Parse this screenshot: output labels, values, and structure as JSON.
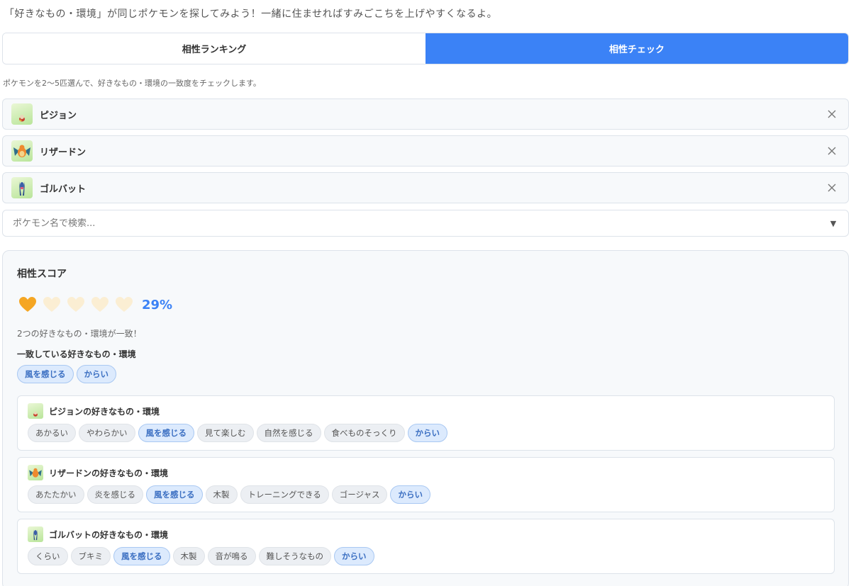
{
  "intro_text": "「好きなもの・環境」が同じポケモンを探してみよう！一緒に住ませればすみごこちを上げやすくなるよ。",
  "tabs": [
    {
      "label": "相性ランキング",
      "active": false
    },
    {
      "label": "相性チェック",
      "active": true
    }
  ],
  "instruction": "ポケモンを2〜5匹選んで、好きなもの・環境の一致度をチェックします。",
  "selected": [
    {
      "name": "ピジョン",
      "icon": "pidgeotto-icon"
    },
    {
      "name": "リザードン",
      "icon": "charizard-icon"
    },
    {
      "name": "ゴルバット",
      "icon": "golbat-icon"
    }
  ],
  "search": {
    "placeholder": "ポケモン名で検索..."
  },
  "result": {
    "title": "相性スコア",
    "hearts_total": 5,
    "hearts_filled": 1,
    "score": "29%",
    "match_text": "2つの好きなもの・環境が一致！",
    "match_heading": "一致している好きなもの・環境",
    "matched_tags": [
      "風を感じる",
      "からい"
    ],
    "cards": [
      {
        "title": "ピジョンの好きなもの・環境",
        "tags": [
          {
            "label": "あかるい",
            "match": false
          },
          {
            "label": "やわらかい",
            "match": false
          },
          {
            "label": "風を感じる",
            "match": true
          },
          {
            "label": "見て楽しむ",
            "match": false
          },
          {
            "label": "自然を感じる",
            "match": false
          },
          {
            "label": "食べものそっくり",
            "match": false
          },
          {
            "label": "からい",
            "match": true
          }
        ]
      },
      {
        "title": "リザードンの好きなもの・環境",
        "tags": [
          {
            "label": "あたたかい",
            "match": false
          },
          {
            "label": "炎を感じる",
            "match": false
          },
          {
            "label": "風を感じる",
            "match": true
          },
          {
            "label": "木製",
            "match": false
          },
          {
            "label": "トレーニングできる",
            "match": false
          },
          {
            "label": "ゴージャス",
            "match": false
          },
          {
            "label": "からい",
            "match": true
          }
        ]
      },
      {
        "title": "ゴルバットの好きなもの・環境",
        "tags": [
          {
            "label": "くらい",
            "match": false
          },
          {
            "label": "ブキミ",
            "match": false
          },
          {
            "label": "風を感じる",
            "match": true
          },
          {
            "label": "木製",
            "match": false
          },
          {
            "label": "音が鳴る",
            "match": false
          },
          {
            "label": "難しそうなもの",
            "match": false
          },
          {
            "label": "からい",
            "match": true
          }
        ]
      }
    ]
  },
  "colors": {
    "accent": "#3b82f6",
    "heart_filled": "#f5a623",
    "heart_empty": "#fbeed3"
  }
}
